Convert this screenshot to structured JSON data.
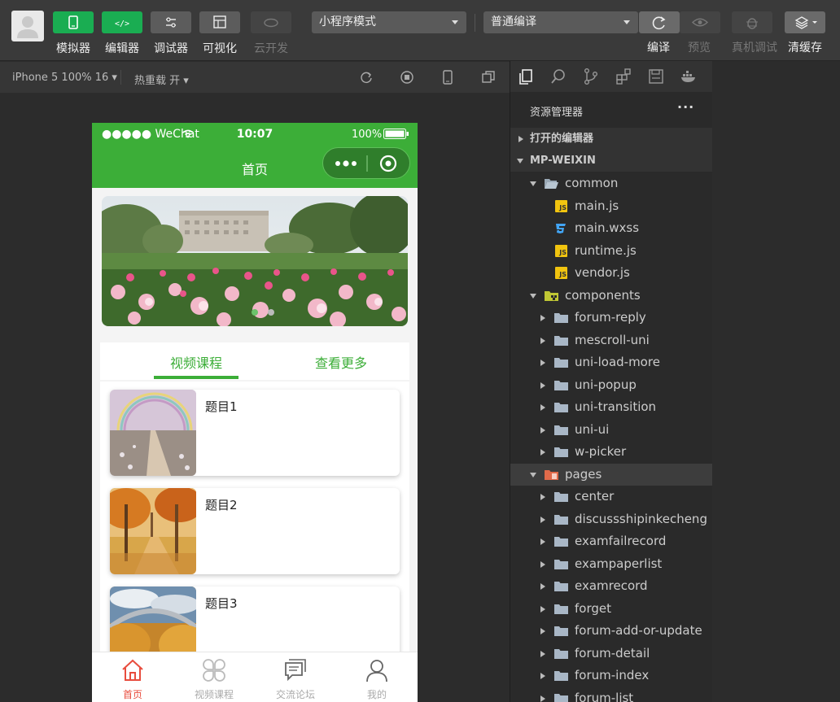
{
  "toolbar": {
    "left_buttons": [
      {
        "label": "模拟器",
        "state": "on"
      },
      {
        "label": "编辑器",
        "state": "on"
      },
      {
        "label": "调试器",
        "state": "normal"
      },
      {
        "label": "可视化",
        "state": "normal"
      },
      {
        "label": "云开发",
        "state": "disabled"
      }
    ],
    "mode_select": "小程序模式",
    "compile_select": "普通编译",
    "right_labels": {
      "compile": "编译",
      "preview": "预览",
      "remote_debug": "真机调试",
      "clear_cache": "清缓存"
    }
  },
  "simbar": {
    "device": "iPhone 5 100% 16",
    "hot_reload": "热重载 开"
  },
  "phone": {
    "status": {
      "carrier": "●●●●● WeChat",
      "time": "10:07",
      "battery": "100%"
    },
    "nav_title": "首页",
    "tabs": [
      "视频课程",
      "查看更多"
    ],
    "cards": [
      {
        "title": "题目1"
      },
      {
        "title": "题目2"
      },
      {
        "title": "题目3"
      }
    ],
    "tabbar": [
      "首页",
      "视频课程",
      "交流论坛",
      "我的"
    ],
    "accent": "#3cae38",
    "tabbar_active": "#e84c3d"
  },
  "explorer": {
    "title": "资源管理器",
    "more": "···",
    "sections": {
      "open_editors": "打开的编辑器",
      "project": "MP-WEIXIN"
    },
    "tree": [
      {
        "label": "common",
        "kind": "folder-open",
        "depth": 1,
        "expanded": true
      },
      {
        "label": "main.js",
        "kind": "js",
        "depth": 2
      },
      {
        "label": "main.wxss",
        "kind": "css",
        "depth": 2
      },
      {
        "label": "runtime.js",
        "kind": "js",
        "depth": 2
      },
      {
        "label": "vendor.js",
        "kind": "js",
        "depth": 2
      },
      {
        "label": "components",
        "kind": "folder-components",
        "depth": 1,
        "expanded": true
      },
      {
        "label": "forum-reply",
        "kind": "folder",
        "depth": 2
      },
      {
        "label": "mescroll-uni",
        "kind": "folder",
        "depth": 2
      },
      {
        "label": "uni-load-more",
        "kind": "folder",
        "depth": 2
      },
      {
        "label": "uni-popup",
        "kind": "folder",
        "depth": 2
      },
      {
        "label": "uni-transition",
        "kind": "folder",
        "depth": 2
      },
      {
        "label": "uni-ui",
        "kind": "folder",
        "depth": 2
      },
      {
        "label": "w-picker",
        "kind": "folder",
        "depth": 2
      },
      {
        "label": "pages",
        "kind": "folder-pages",
        "depth": 1,
        "expanded": true,
        "highlight": true
      },
      {
        "label": "center",
        "kind": "folder",
        "depth": 2
      },
      {
        "label": "discussshipinkecheng",
        "kind": "folder",
        "depth": 2
      },
      {
        "label": "examfailrecord",
        "kind": "folder",
        "depth": 2
      },
      {
        "label": "exampaperlist",
        "kind": "folder",
        "depth": 2
      },
      {
        "label": "examrecord",
        "kind": "folder",
        "depth": 2
      },
      {
        "label": "forget",
        "kind": "folder",
        "depth": 2
      },
      {
        "label": "forum-add-or-update",
        "kind": "folder",
        "depth": 2
      },
      {
        "label": "forum-detail",
        "kind": "folder",
        "depth": 2
      },
      {
        "label": "forum-index",
        "kind": "folder",
        "depth": 2
      },
      {
        "label": "forum-list",
        "kind": "folder",
        "depth": 2
      }
    ]
  }
}
